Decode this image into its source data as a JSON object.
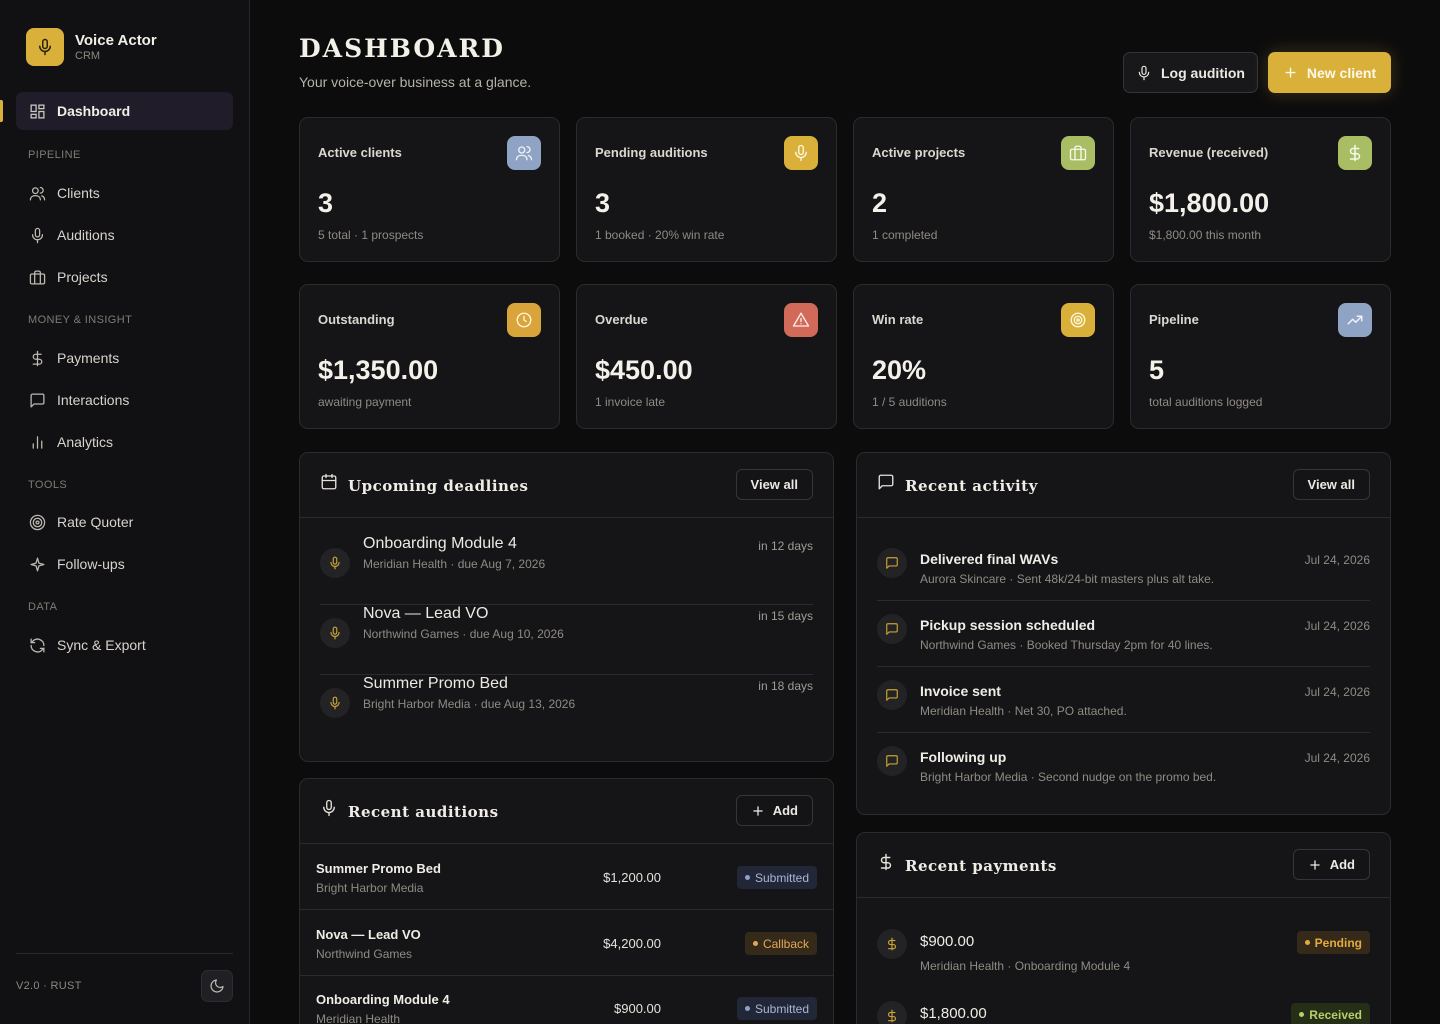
{
  "app": {
    "name": "Voice Actor",
    "sub": "CRM",
    "version": "V2.0 · RUST"
  },
  "colors": {
    "accent": "#d9b13a",
    "background": "#0c0c0d",
    "card": "#151517"
  },
  "sidebar": {
    "dashboard": "Dashboard",
    "sections": {
      "pipeline": "PIPELINE",
      "money": "MONEY & INSIGHT",
      "tools": "TOOLS",
      "data": "DATA"
    },
    "items": {
      "clients": "Clients",
      "auditions": "Auditions",
      "projects": "Projects",
      "payments": "Payments",
      "interactions": "Interactions",
      "analytics": "Analytics",
      "rate_quoter": "Rate Quoter",
      "follow_ups": "Follow-ups",
      "sync_export": "Sync & Export"
    }
  },
  "header": {
    "title": "DASHBOARD",
    "subtitle": "Your voice-over business at a glance.",
    "log_audition": "Log audition",
    "new_client": "New client"
  },
  "stats": [
    {
      "label": "Active clients",
      "value": "3",
      "sub": "5 total · 1 prospects",
      "icon": "users-icon",
      "color": "#8fa3c4"
    },
    {
      "label": "Pending auditions",
      "value": "3",
      "sub": "1 booked · 20% win rate",
      "icon": "mic-icon",
      "color": "#d9b13a"
    },
    {
      "label": "Active projects",
      "value": "2",
      "sub": "1 completed",
      "icon": "briefcase-icon",
      "color": "#a8bd64"
    },
    {
      "label": "Revenue (received)",
      "value": "$1,800.00",
      "sub": "$1,800.00 this month",
      "icon": "dollar-icon",
      "color": "#a8bd64"
    },
    {
      "label": "Outstanding",
      "value": "$1,350.00",
      "sub": "awaiting payment",
      "icon": "clock-icon",
      "color": "#d9a53a"
    },
    {
      "label": "Overdue",
      "value": "$450.00",
      "sub": "1 invoice late",
      "icon": "alert-icon",
      "color": "#d26a5a"
    },
    {
      "label": "Win rate",
      "value": "20%",
      "sub": "1 / 5 auditions",
      "icon": "target-icon",
      "color": "#d9b13a"
    },
    {
      "label": "Pipeline",
      "value": "5",
      "sub": "total auditions logged",
      "icon": "trending-up-icon",
      "color": "#8fa3c4"
    }
  ],
  "deadlines": {
    "title": "Upcoming deadlines",
    "view_all": "View all",
    "items": [
      {
        "title": "Onboarding Module 4",
        "sub": "Meridian Health · due Aug 7, 2026",
        "when": "in 12 days"
      },
      {
        "title": "Nova — Lead VO",
        "sub": "Northwind Games · due Aug 10, 2026",
        "when": "in 15 days"
      },
      {
        "title": "Summer Promo Bed",
        "sub": "Bright Harbor Media · due Aug 13, 2026",
        "when": "in 18 days"
      }
    ]
  },
  "activity": {
    "title": "Recent activity",
    "view_all": "View all",
    "items": [
      {
        "title": "Delivered final WAVs",
        "sub": "Aurora Skincare · Sent 48k/24-bit masters plus alt take.",
        "date": "Jul 24, 2026"
      },
      {
        "title": "Pickup session scheduled",
        "sub": "Northwind Games · Booked Thursday 2pm for 40 lines.",
        "date": "Jul 24, 2026"
      },
      {
        "title": "Invoice sent",
        "sub": "Meridian Health · Net 30, PO attached.",
        "date": "Jul 24, 2026"
      },
      {
        "title": "Following up",
        "sub": "Bright Harbor Media · Second nudge on the promo bed.",
        "date": "Jul 24, 2026"
      }
    ]
  },
  "auditions": {
    "title": "Recent auditions",
    "add": "Add",
    "items": [
      {
        "title": "Summer Promo Bed",
        "client": "Bright Harbor Media",
        "amount": "$1,200.00",
        "status": "Submitted"
      },
      {
        "title": "Nova — Lead VO",
        "client": "Northwind Games",
        "amount": "$4,200.00",
        "status": "Callback"
      },
      {
        "title": "Onboarding Module 4",
        "client": "Meridian Health",
        "amount": "$900.00",
        "status": "Submitted"
      }
    ]
  },
  "payments": {
    "title": "Recent payments",
    "add": "Add",
    "items": [
      {
        "amount": "$900.00",
        "sub": "Meridian Health · Onboarding Module 4",
        "status": "Pending"
      },
      {
        "amount": "$1,800.00",
        "sub": "",
        "status": "Received"
      }
    ]
  }
}
